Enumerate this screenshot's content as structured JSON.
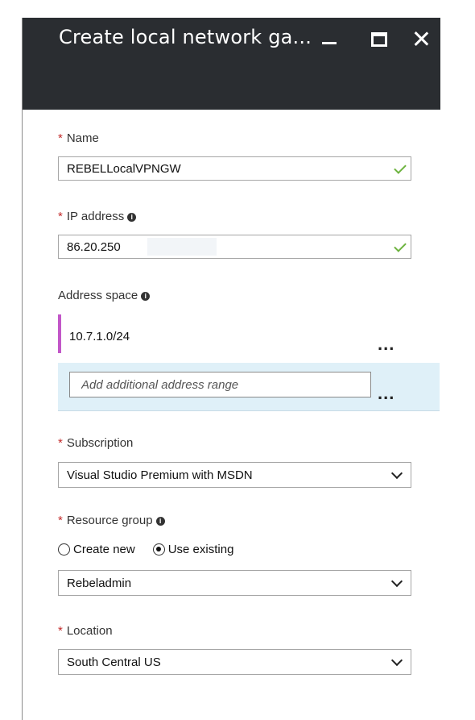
{
  "blade": {
    "title": "Create local network ga...",
    "window_controls": {
      "minimize_icon": "minimize-icon",
      "maximize_icon": "maximize-icon",
      "close_icon": "close-icon"
    }
  },
  "form": {
    "name": {
      "required_mark": "*",
      "label": "Name",
      "value": "REBELLocalVPNGW",
      "valid": true
    },
    "ip_address": {
      "required_mark": "*",
      "label": "IP address",
      "info": "i",
      "value": "86.20.250",
      "valid": true
    },
    "address_space": {
      "label": "Address space",
      "info": "i",
      "entries": [
        "10.7.1.0/24"
      ],
      "more": "...",
      "add_placeholder": "Add additional address range",
      "add_more": "..."
    },
    "subscription": {
      "required_mark": "*",
      "label": "Subscription",
      "value": "Visual Studio Premium with MSDN"
    },
    "resource_group": {
      "required_mark": "*",
      "label": "Resource group",
      "info": "i",
      "options": [
        {
          "label": "Create new",
          "selected": false
        },
        {
          "label": "Use existing",
          "selected": true
        }
      ],
      "value": "Rebeladmin"
    },
    "location": {
      "required_mark": "*",
      "label": "Location",
      "value": "South Central US"
    }
  },
  "colors": {
    "header_bg": "#2a2d31",
    "required_star": "#c32b2b",
    "valid_check": "#6db33f",
    "selected_row_accent": "#c257c8",
    "add_row_bg": "#dff0f8"
  }
}
